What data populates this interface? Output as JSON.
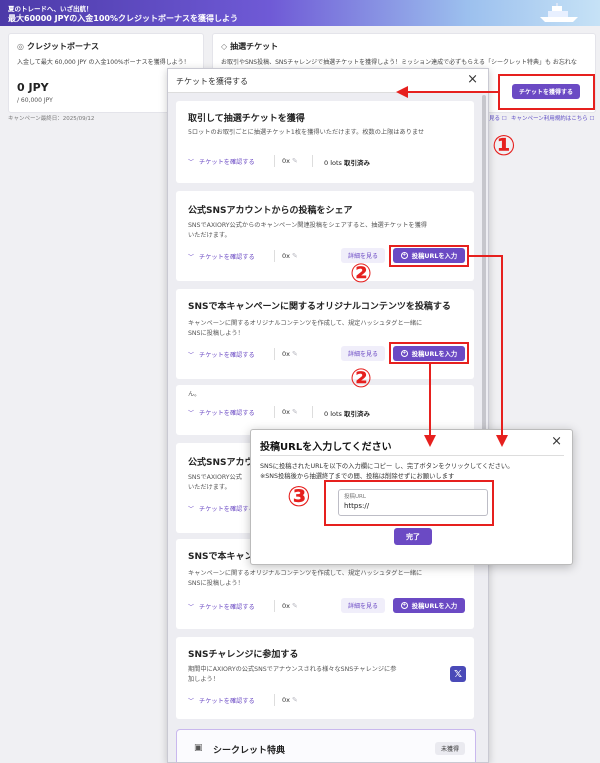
{
  "banner": {
    "line1": "夏のトレードへ、いざ出航！",
    "line2": "最大60000 JPYの入金100%クレジットボーナスを獲得しよう"
  },
  "credit_card": {
    "title": "クレジットボーナス",
    "desc": "入金して最大 60,000 JPY の入金100%ボーナスを獲得しよう！",
    "value": "0 JPY",
    "sub": "/ 60,000 JPY",
    "expire": "キャンペーン最終日：2025/09/12"
  },
  "ticket_card": {
    "title": "抽選チケット",
    "desc": "お取引やSNS投稿、SNSチャレンジで抽選チケットを獲得しよう！ミッション達成で必ずもらえる「シークレット特典」も お忘れな",
    "get_button": "チケットを獲得する",
    "link1": "見る",
    "link2": "キャンペーン利用規約はこちら"
  },
  "modal": {
    "title": "チケットを獲得する",
    "close": "×",
    "confirm_label": "チケットを確認する",
    "detail_label": "詳細を見る",
    "url_label": "投稿URLを入力",
    "count": "0x",
    "lots_value": "0 lots",
    "lots_suffix": "取引済み",
    "sections": [
      {
        "title": "取引して抽選チケットを獲得",
        "desc1": "5ロットのお取引ごとに抽選チケット1枚を獲得いただけます。枚数の上限はありませ",
        "desc2": "ん。"
      },
      {
        "title": "公式SNSアカウントからの投稿をシェア",
        "desc1": "SNSでAXIORY公式からのキャンペーン関連投稿をシェアすると、抽選チケットを獲得",
        "desc2": "いただけます。"
      },
      {
        "title": "SNSで本キャンペーンに関するオリジナルコンテンツを投稿する",
        "desc1": "キャンペーンに関するオリジナルコンテンツを作成して、規定ハッシュタグと一緒に",
        "desc2": "SNSに投稿しよう！"
      },
      {
        "desc1": "ん。"
      },
      {
        "title": "公式SNSアカウ",
        "desc1": "SNSでAXIORY公式",
        "desc2": "いただけます。"
      },
      {
        "title": "SNSで本キャン",
        "desc1": "キャンペーンに関するオリジナルコンテンツを作成して、規定ハッシュタグと一緒に",
        "desc2": "SNSに投稿しよう！"
      },
      {
        "title": "SNSチャレンジに参加する",
        "desc1": "期間中にAXIORYの公式SNSでアナウンスされる様々なSNSチャレンジに参",
        "desc2": "加しよう！",
        "x_glyph": "𝕏"
      }
    ],
    "secret_title": "シークレット特典",
    "secret_badge": "未獲得"
  },
  "url_modal": {
    "title": "投稿URLを入力してください",
    "close": "×",
    "desc1": "SNSに投稿されたURLを以下の入力欄にコピー し、完了ボタンをクリックしてください。",
    "desc2": "※SNS投稿後から抽選終了までの間、投稿は削除せずにお願いします",
    "field_label": "投稿URL",
    "field_value": "https://",
    "submit": "完了"
  },
  "annotations": {
    "n1": "①",
    "n2": "②",
    "n3": "③",
    "color": "#e6201e"
  },
  "colors": {
    "accent": "#6b4ac4"
  }
}
